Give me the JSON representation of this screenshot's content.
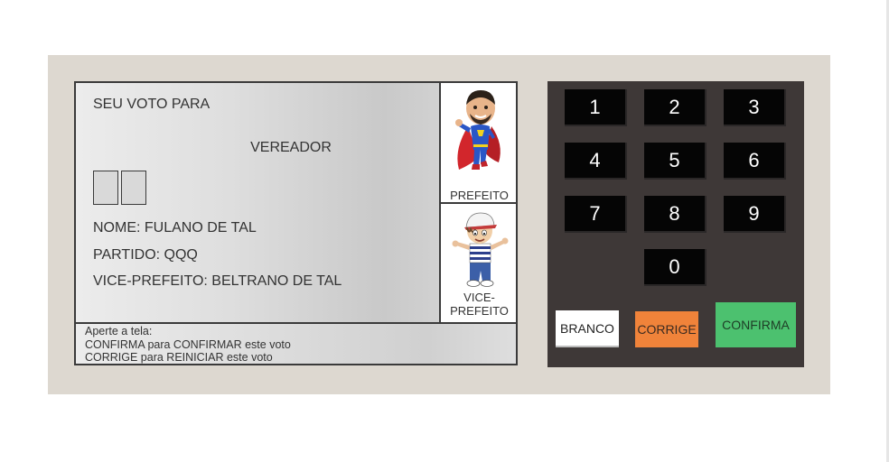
{
  "screen": {
    "seu_voto_para": "SEU VOTO PARA",
    "cargo": "VEREADOR",
    "nome": "NOME: FULANO DE TAL",
    "partido": "PARTIDO: QQQ",
    "vice_prefeito": "VICE-PREFEITO: BELTRANO DE TAL",
    "candidates": {
      "prefeito_label": "PREFEITO",
      "vice_label_line1": "VICE-",
      "vice_label_line2": "PREFEITO"
    },
    "footer": {
      "line1": "Aperte a tela:",
      "line2": "CONFIRMA para CONFIRMAR este voto",
      "line3": "CORRIGE para REINICIAR este voto"
    }
  },
  "keypad": {
    "keys": [
      "1",
      "2",
      "3",
      "4",
      "5",
      "6",
      "7",
      "8",
      "9",
      "0"
    ],
    "branco": "BRANCO",
    "corrige": "CORRIGE",
    "confirma": "CONFIRMA"
  },
  "colors": {
    "corrige": "#f0833a",
    "confirma": "#4cc16f",
    "branco": "#ffffff",
    "keypad_background": "#3e3837"
  }
}
